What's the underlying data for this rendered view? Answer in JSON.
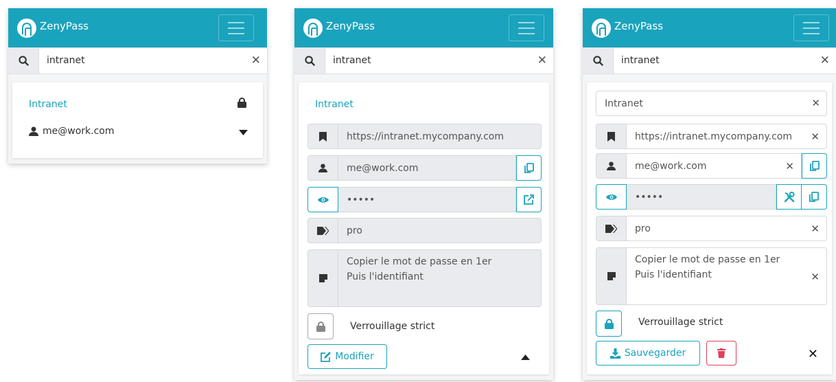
{
  "app": {
    "name": "ZenyPass"
  },
  "search": {
    "value": "intranet"
  },
  "colors": {
    "accent": "#1aa3bd",
    "danger": "#e0405a",
    "addon_bg": "#e9ebee"
  },
  "panel1": {
    "title": "Intranet",
    "user": "me@work.com"
  },
  "panel2": {
    "title": "Intranet",
    "url": "https://intranet.mycompany.com",
    "login": "me@work.com",
    "password": "•••••",
    "tag": "pro",
    "note_line1": "Copier le mot de passe en 1er",
    "note_line2": "Puis l'identifiant",
    "strict_lock_label": "Verrouillage strict",
    "edit_label": "Modifier"
  },
  "panel3": {
    "title": "Intranet",
    "url": "https://intranet.mycompany.com",
    "login": "me@work.com",
    "password": "•••••",
    "tag": "pro",
    "note_line1": "Copier le mot de passe en 1er",
    "note_line2": "Puis l'identifiant",
    "strict_lock_label": "Verrouillage strict",
    "save_label": "Sauvegarder"
  }
}
